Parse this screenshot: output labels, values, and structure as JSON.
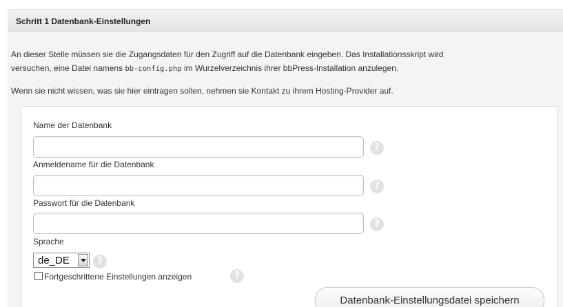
{
  "panel": {
    "title": "Schritt 1 Datenbank-Einstellungen"
  },
  "intro": {
    "line1": "An dieser Stelle müssen sie die Zugangsdaten für den Zugriff auf die Datenbank eingeben. Das Installationsskript wird",
    "line2_before": "versuchen, eine Datei namens ",
    "line2_code": "bb-config.php",
    "line2_after": " im Wurzelverzeichnis ihrer bbPress-Installation anzulegen.",
    "paragraph2": "Wenn sie nicht wissen, was sie hier eintragen sollen, nehmen sie Kontakt zu ihrem Hosting-Provider auf."
  },
  "form": {
    "db_name_label": "Name der Datenbank",
    "db_name_value": "",
    "db_user_label": "Anmeldename für die Datenbank",
    "db_user_value": "",
    "db_password_label": "Passwort für die Datenbank",
    "db_password_value": "",
    "language_label": "Sprache",
    "language_selected": "de_DE",
    "advanced_label": "Fortgeschrittene Einstellungen anzeigen",
    "advanced_checked": false,
    "help_glyph": "?",
    "submit_label": "Datenbank-Einstellungsdatei speichern"
  },
  "icons": {
    "help": "help-icon",
    "dropdown": "chevron-down-icon"
  },
  "colors": {
    "panel_bg": "#f4f4f4",
    "header_bg": "#e8e8e8",
    "help_icon_bg": "#e2e2e2",
    "border": "#bcbcbc"
  }
}
